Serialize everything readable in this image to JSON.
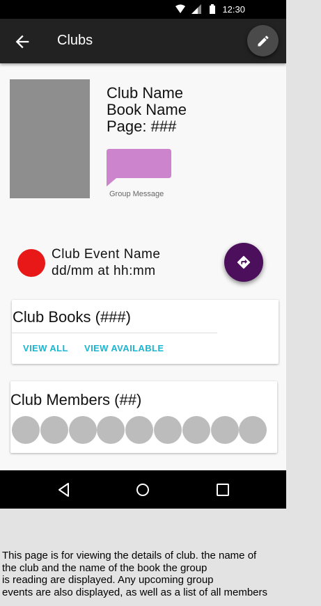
{
  "status_bar": {
    "time": "12:30",
    "icons": [
      "wifi-icon",
      "signal-icon",
      "battery-icon"
    ]
  },
  "app_bar": {
    "title": "Clubs",
    "back_icon": "arrow-back-icon",
    "action_icon": "pencil-edit-icon"
  },
  "club": {
    "club_name": "Club Name",
    "book_name": "Book Name",
    "page": "Page: ###",
    "message_label": "Group Message",
    "message_color": "#cc84cc",
    "cover_color": "#8e8e8e"
  },
  "event": {
    "name": "Club Event Name",
    "datetime": "dd/mm at hh:mm",
    "dot_color": "#e81818",
    "directions_icon": "directions-icon",
    "fab_color": "#4b0f5c"
  },
  "books_card": {
    "title": "Club Books (###)",
    "view_all": "VIEW ALL",
    "view_available": "VIEW AVAILABLE",
    "link_color": "#1ab5d2"
  },
  "members_card": {
    "title": "Club Members (##)",
    "avatar_count": 9
  },
  "nav_bar": {
    "icons": [
      "back-triangle-icon",
      "home-circle-icon",
      "recents-square-icon"
    ]
  },
  "caption": [
    "This page is for viewing the details of club. the name of",
    "the club and the name of the book the group",
    "is reading are displayed. Any upcoming group",
    "events are also displayed, as well as a list of all members"
  ]
}
